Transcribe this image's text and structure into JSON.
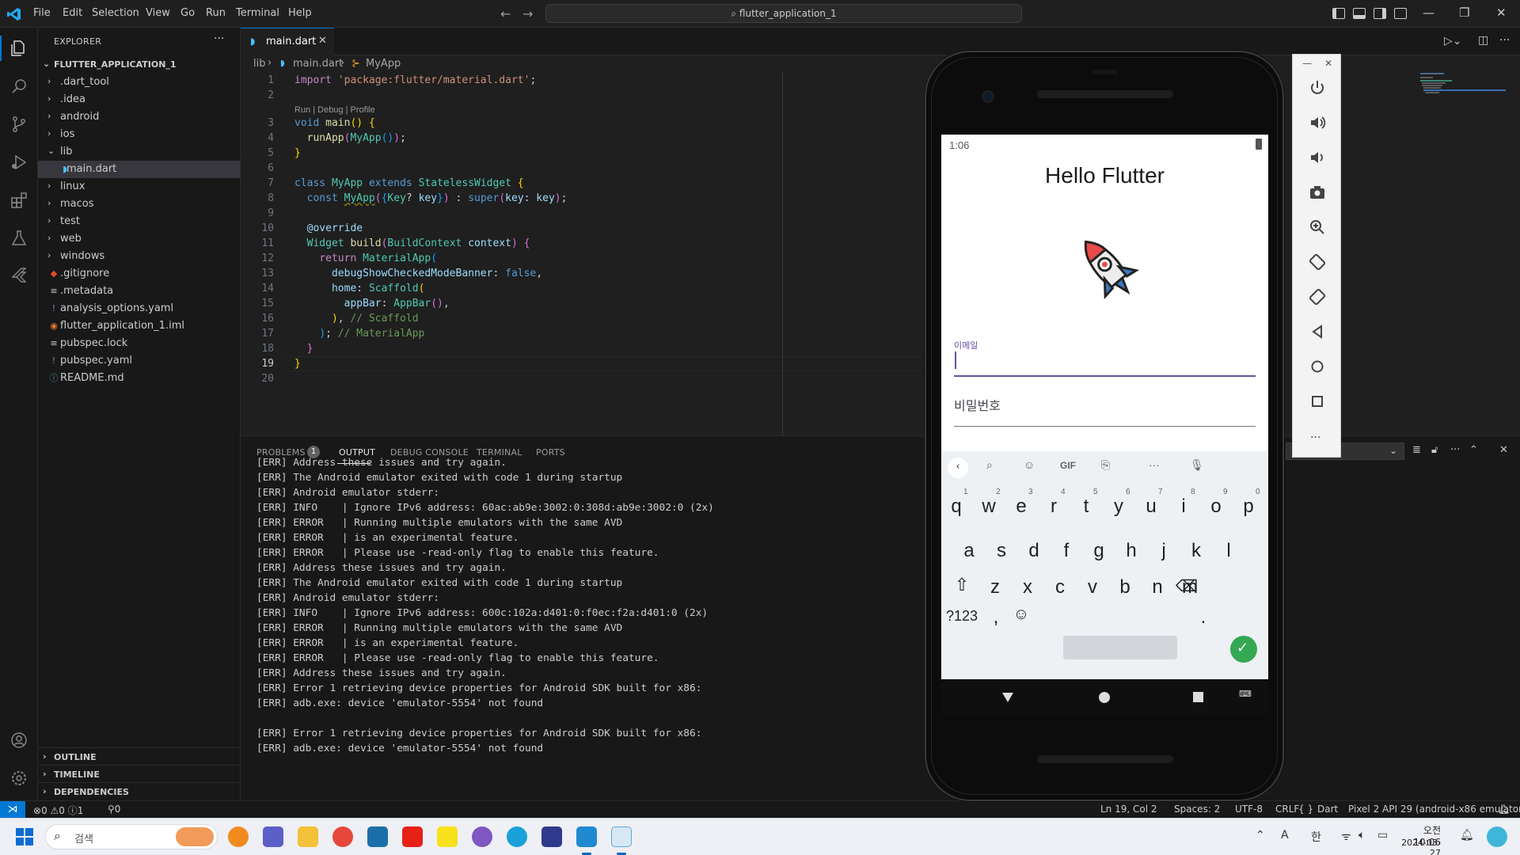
{
  "menubar": {
    "items": [
      "File",
      "Edit",
      "Selection",
      "View",
      "Go",
      "Run",
      "Terminal",
      "Help"
    ],
    "search": "flutter_application_1"
  },
  "sidebar": {
    "title": "EXPLORER",
    "project": "FLUTTER_APPLICATION_1",
    "items": [
      {
        "label": ".dart_tool",
        "type": "folder"
      },
      {
        "label": ".idea",
        "type": "folder"
      },
      {
        "label": "android",
        "type": "folder"
      },
      {
        "label": "ios",
        "type": "folder"
      },
      {
        "label": "lib",
        "type": "folder-open"
      },
      {
        "label": "main.dart",
        "type": "dart"
      },
      {
        "label": "linux",
        "type": "folder"
      },
      {
        "label": "macos",
        "type": "folder"
      },
      {
        "label": "test",
        "type": "folder"
      },
      {
        "label": "web",
        "type": "folder"
      },
      {
        "label": "windows",
        "type": "folder"
      },
      {
        "label": ".gitignore",
        "type": "git"
      },
      {
        "label": ".metadata",
        "type": "lines"
      },
      {
        "label": "analysis_options.yaml",
        "type": "yaml"
      },
      {
        "label": "flutter_application_1.iml",
        "type": "rss"
      },
      {
        "label": "pubspec.lock",
        "type": "lines"
      },
      {
        "label": "pubspec.yaml",
        "type": "yaml"
      },
      {
        "label": "README.md",
        "type": "info"
      }
    ],
    "sections": [
      "OUTLINE",
      "TIMELINE",
      "DEPENDENCIES"
    ]
  },
  "editor": {
    "tab": "main.dart",
    "breadcrumb": [
      "lib",
      "main.dart",
      "MyApp"
    ],
    "codelens": "Run | Debug | Profile",
    "current_line": 19
  },
  "panel": {
    "tabs": [
      "PROBLEMS",
      "OUTPUT",
      "DEBUG CONSOLE",
      "TERMINAL",
      "PORTS"
    ],
    "problems_count": "1",
    "dropdown": "on",
    "output": [
      "[ERR] Address these issues and try again.",
      "[ERR] The Android emulator exited with code 1 during startup",
      "[ERR] Android emulator stderr:",
      "[ERR] INFO    | Ignore IPv6 address: 60ac:ab9e:3002:0:308d:ab9e:3002:0 (2x)",
      "[ERR] ERROR   | Running multiple emulators with the same AVD",
      "[ERR] ERROR   | is an experimental feature.",
      "[ERR] ERROR   | Please use -read-only flag to enable this feature.",
      "[ERR] Address these issues and try again.",
      "[ERR] The Android emulator exited with code 1 during startup",
      "[ERR] Android emulator stderr:",
      "[ERR] INFO    | Ignore IPv6 address: 600c:102a:d401:0:f0ec:f2a:d401:0 (2x)",
      "[ERR] ERROR   | Running multiple emulators with the same AVD",
      "[ERR] ERROR   | is an experimental feature.",
      "[ERR] ERROR   | Please use -read-only flag to enable this feature.",
      "[ERR] Address these issues and try again.",
      "[ERR] Error 1 retrieving device properties for Android SDK built for x86:",
      "[ERR] adb.exe: device 'emulator-5554' not found",
      "",
      "[ERR] Error 1 retrieving device properties for Android SDK built for x86:",
      "[ERR] adb.exe: device 'emulator-5554' not found"
    ]
  },
  "statusbar": {
    "errors": "0",
    "warnings": "0",
    "info": "1",
    "ports": "0",
    "position": "Ln 19, Col 2",
    "spaces": "Spaces: 2",
    "encoding": "UTF-8",
    "eol": "CRLF",
    "language": "Dart",
    "device": "Pixel 2 API 29 (android-x86 emulator)"
  },
  "emulator": {
    "time": "1:06",
    "app_title": "Hello Flutter",
    "email_label": "이메일",
    "password_label": "비밀번호",
    "keyboard": {
      "toolbar": [
        "GIF"
      ],
      "row1": [
        "q",
        "w",
        "e",
        "r",
        "t",
        "y",
        "u",
        "i",
        "o",
        "p"
      ],
      "row1_hints": [
        "1",
        "2",
        "3",
        "4",
        "5",
        "6",
        "7",
        "8",
        "9",
        "0"
      ],
      "row2": [
        "a",
        "s",
        "d",
        "f",
        "g",
        "h",
        "j",
        "k",
        "l"
      ],
      "row3": [
        "z",
        "x",
        "c",
        "v",
        "b",
        "n",
        "m"
      ],
      "sym": "?123",
      "comma": ",",
      "period": "."
    }
  },
  "taskbar": {
    "search": "검색",
    "ime": "한",
    "font_icon": "A",
    "time": "오전 10:06",
    "date": "2024-03-27"
  },
  "colors": {
    "accent": "#0078d4",
    "flutter_purple": "#6750a4",
    "enter_green": "#34a853"
  }
}
